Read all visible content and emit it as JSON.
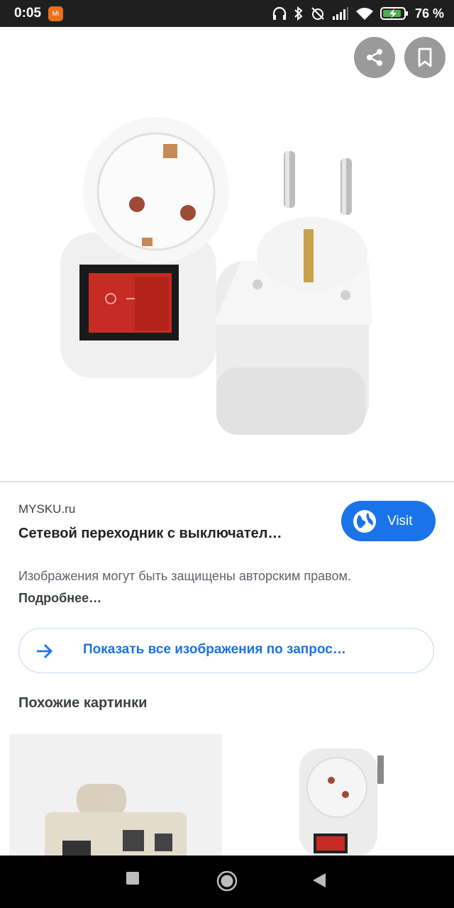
{
  "status_bar": {
    "time": "0:05",
    "app_badge_text": "Mi",
    "battery_percent": "76 %"
  },
  "hero": {
    "image_subject": "outlet-adapter-with-switch",
    "actions": [
      "share-icon",
      "bookmark-icon"
    ]
  },
  "result": {
    "source": "MYSKU.ru",
    "title": "Сетевой переходник с выключател…",
    "visit_label": "Visit",
    "copyright_text": "Изображения могут быть защищены авторским правом. ",
    "copyright_link": "Подробнее…"
  },
  "show_all": {
    "label": "Показать все изображения по запрос…"
  },
  "similar": {
    "heading": "Похожие картинки"
  },
  "colors": {
    "accent": "#1a73e8",
    "switch_red": "#c62b24"
  }
}
